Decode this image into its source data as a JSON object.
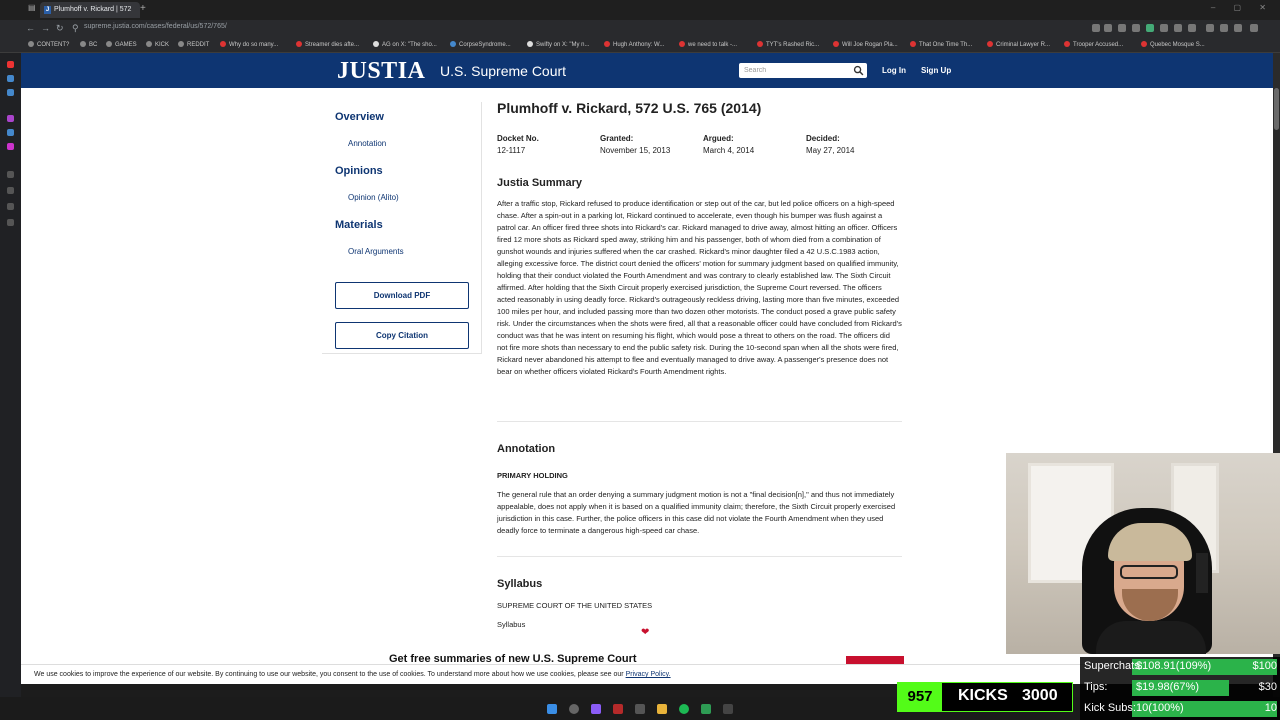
{
  "browser": {
    "tab_title": "Plumhoff v. Rickard | 572",
    "tab_favicon": "J",
    "url": "supreme.justia.com/cases/federal/us/572/765/",
    "bookmarks": [
      "CONTENT?",
      "BC",
      "GAMES",
      "KICK",
      "REDDIT",
      "Why do so many...",
      "Streamer dies afte...",
      "AG on X: \"The sho...",
      "CorpseSyndrome...",
      "Swifty on X: \"My n...",
      "Hugh Anthony: W...",
      "we need to talk -...",
      "TYT's Rashed Ric...",
      "Will Joe Rogan Pla...",
      "That One Time Th...",
      "Criminal Lawyer R...",
      "Trooper Accused...",
      "Quebec Mosque S..."
    ]
  },
  "header": {
    "logo": "JUSTIA",
    "logo_sub": "U.S. Supreme Court",
    "search_placeholder": "Search",
    "login": "Log In",
    "signup": "Sign Up"
  },
  "sidebar": {
    "overview": "Overview",
    "annotation": "Annotation",
    "opinions": "Opinions",
    "opinion_alito": "Opinion (Alito)",
    "materials": "Materials",
    "oral_arguments": "Oral Arguments",
    "download_pdf": "Download PDF",
    "copy_citation": "Copy Citation"
  },
  "case": {
    "title": "Plumhoff v. Rickard, 572 U.S. 765 (2014)",
    "docket_label": "Docket No.",
    "docket_value": "12-1117",
    "granted_label": "Granted:",
    "granted_value": "November 15, 2013",
    "argued_label": "Argued:",
    "argued_value": "March 4, 2014",
    "decided_label": "Decided:",
    "decided_value": "May 27, 2014"
  },
  "summary": {
    "title": "Justia Summary",
    "text": "After a traffic stop, Rickard refused to produce identification or step out of the car, but led police officers on a high-speed chase. After a spin-out in a parking lot, Rickard continued to accelerate, even though his bumper was flush against a patrol car. An officer fired three shots into Rickard's car. Rickard managed to drive away, almost hitting an officer. Officers fired 12 more shots as Rickard sped away, striking him and his passenger, both of whom died from a combination of gunshot wounds and injuries suffered when the car crashed. Rickard's minor daughter filed a 42 U.S.C.1983 action, alleging excessive force. The district court denied the officers' motion for summary judgment based on qualified immunity, holding that their conduct violated the Fourth Amendment and was contrary to clearly established law. The Sixth Circuit affirmed. After holding that the Sixth Circuit properly exercised jurisdiction, the Supreme Court reversed. The officers acted reasonably in using deadly force. Rickard's outrageously reckless driving, lasting more than five minutes, exceeded 100 miles per hour, and included passing more than two dozen other motorists. The conduct posed a grave public safety risk. Under the circumstances when the shots were fired, all that a reasonable officer could have concluded from Rickard's conduct was that he was intent on resuming his flight, which would pose a threat to others on the road. The officers did not fire more shots than necessary to end the public safety risk. During the 10-second span when all the shots were fired, Rickard never abandoned his attempt to flee and eventually managed to drive away. A passenger's presence does not bear on whether officers violated Rickard's Fourth Amendment rights."
  },
  "annotation": {
    "title": "Annotation",
    "holding_label": "PRIMARY HOLDING",
    "text": "The general rule that an order denying a summary judgment motion is not a \"final decision[n],\" and thus not immediately appealable, does not apply when it is based on a qualified immunity claim; therefore, the Sixth Circuit properly exercised jurisdiction in this case. Further, the police officers in this case did not violate the Fourth Amendment when they used deadly force to terminate a dangerous high-speed car chase."
  },
  "syllabus": {
    "title": "Syllabus",
    "court": "SUPREME COURT OF THE UNITED STATES",
    "label": "Syllabus"
  },
  "promo": {
    "text": "Get free summaries of new U.S. Supreme Court"
  },
  "cookie": {
    "text": "We use cookies to improve the experience of our website. By continuing to use our website, you consent to the use of cookies. To understand more about how we use cookies, please see our",
    "link": "Privacy Policy."
  },
  "stream": {
    "kicks_count": "957",
    "kicks_label": "KICKS",
    "kicks_goal": "3000",
    "superchats_label": "Superchats:",
    "superchats_value": "$108.91(109%)",
    "superchats_goal": "$100",
    "superchats_progress": 1.0,
    "tips_label": "Tips:",
    "tips_value": "$19.98(67%)",
    "tips_goal": "$30",
    "tips_progress": 0.67,
    "subs_label": "Kick Subs:",
    "subs_value": "10(100%)",
    "subs_goal": "10",
    "subs_progress": 1.0
  },
  "colors": {
    "brand_navy": "#0e3572",
    "kick_green": "#53fc18",
    "accent_red": "#c8102e"
  }
}
